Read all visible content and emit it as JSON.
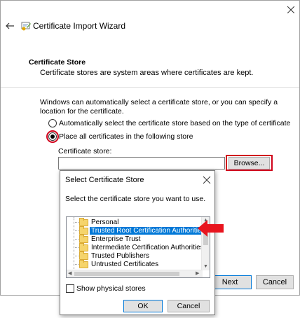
{
  "wizard": {
    "title": "Certificate Import Wizard",
    "section_title": "Certificate Store",
    "section_desc": "Certificate stores are system areas where certificates are kept.",
    "intro": "Windows can automatically select a certificate store, or you can specify a location for the certificate.",
    "radio_auto": "Automatically select the certificate store based on the type of certificate",
    "radio_place": "Place all certificates in the following store",
    "radio_selected": "place",
    "store_label": "Certificate store:",
    "store_value": "",
    "browse_label": "Browse...",
    "next_label": "Next",
    "cancel_label": "Cancel"
  },
  "dialog": {
    "title": "Select Certificate Store",
    "description": "Select the certificate store you want to use.",
    "stores": [
      "Personal",
      "Trusted Root Certification Authorities",
      "Enterprise Trust",
      "Intermediate Certification Authorities",
      "Trusted Publishers",
      "Untrusted Certificates"
    ],
    "selected_index": 1,
    "show_physical_label": "Show physical stores",
    "show_physical_checked": false,
    "ok_label": "OK",
    "cancel_label": "Cancel"
  },
  "colors": {
    "highlight": "#d0021b",
    "selection": "#0078d7",
    "folder": "#f5d46b"
  },
  "icons": {
    "back": "back-arrow-icon",
    "wizard": "certificate-wizard-icon",
    "close": "close-icon",
    "folder": "folder-icon",
    "pointer": "red-arrow-icon"
  }
}
